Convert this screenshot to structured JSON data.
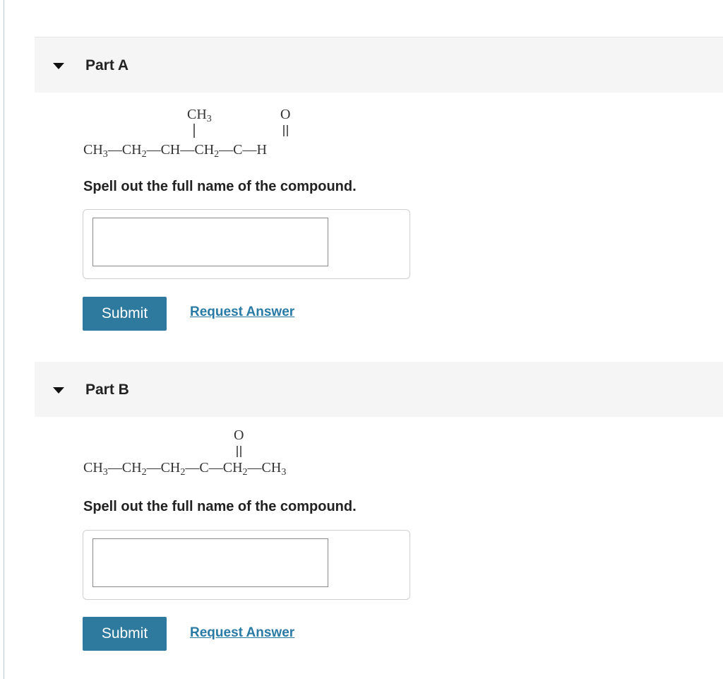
{
  "parts": [
    {
      "title": "Part A",
      "formula": {
        "main": [
          "CH",
          "3",
          "—CH",
          "2",
          "—CH—CH",
          "2",
          "—C—H"
        ],
        "branch": [
          "CH",
          "3"
        ],
        "carbonyl": "O"
      },
      "prompt": "Spell out the full name of the compound.",
      "input_value": "",
      "submit_label": "Submit",
      "request_label": "Request Answer"
    },
    {
      "title": "Part B",
      "formula": {
        "main": [
          "CH",
          "3",
          "—CH",
          "2",
          "—CH",
          "2",
          "—C—CH",
          "2",
          "—CH",
          "3"
        ],
        "carbonyl": "O"
      },
      "prompt": "Spell out the full name of the compound.",
      "input_value": "",
      "submit_label": "Submit",
      "request_label": "Request Answer"
    }
  ]
}
